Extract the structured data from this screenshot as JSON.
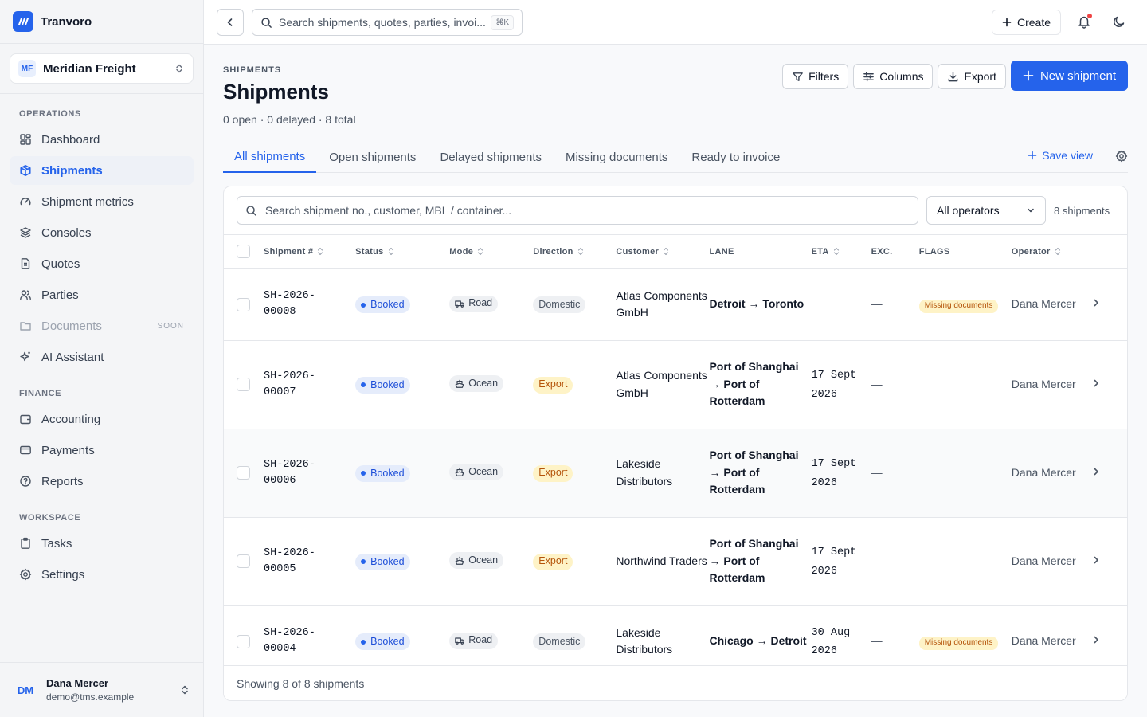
{
  "app": {
    "brand": "Tranvoro",
    "org": {
      "initials": "MF",
      "name": "Meridian Freight"
    },
    "accent": "#2563eb"
  },
  "sidebar": {
    "sections": [
      {
        "heading": "OPERATIONS",
        "items": [
          {
            "label": "Dashboard",
            "icon": "dashboard-icon"
          },
          {
            "label": "Shipments",
            "icon": "package-icon",
            "active": true
          },
          {
            "label": "Shipment metrics",
            "icon": "gauge-icon"
          },
          {
            "label": "Consoles",
            "icon": "layers-icon"
          },
          {
            "label": "Quotes",
            "icon": "file-text-icon"
          },
          {
            "label": "Parties",
            "icon": "users-icon"
          },
          {
            "label": "Documents",
            "icon": "folder-icon",
            "disabled": true,
            "tag": "SOON"
          },
          {
            "label": "AI Assistant",
            "icon": "sparkles-icon"
          }
        ]
      },
      {
        "heading": "FINANCE",
        "items": [
          {
            "label": "Accounting",
            "icon": "wallet-icon"
          },
          {
            "label": "Payments",
            "icon": "credit-card-icon"
          },
          {
            "label": "Reports",
            "icon": "help-circle-icon"
          }
        ]
      },
      {
        "heading": "WORKSPACE",
        "items": [
          {
            "label": "Tasks",
            "icon": "clipboard-icon"
          },
          {
            "label": "Settings",
            "icon": "gear-icon"
          }
        ]
      }
    ],
    "user": {
      "initials": "DM",
      "name": "Dana Mercer",
      "email": "demo@tms.example"
    }
  },
  "topbar": {
    "search_placeholder": "Search shipments, quotes, parties, invoi...",
    "shortcut": "⌘K",
    "create_label": "Create"
  },
  "page": {
    "eyebrow": "SHIPMENTS",
    "title": "Shipments",
    "subtitle": "0 open · 0 delayed · 8 total",
    "actions": {
      "filters": "Filters",
      "columns": "Columns",
      "export": "Export",
      "new": "New shipment"
    },
    "tabs": [
      "All shipments",
      "Open shipments",
      "Delayed shipments",
      "Missing documents",
      "Ready to invoice"
    ],
    "active_tab": 0,
    "save_view": "Save view"
  },
  "table": {
    "search_placeholder": "Search shipment no., customer, MBL / container...",
    "operator_filter": "All operators",
    "count": "8 shipments",
    "columns": [
      "Shipment #",
      "Status",
      "Mode",
      "Direction",
      "Customer",
      "LANE",
      "ETA",
      "EXC.",
      "FLAGS",
      "Operator"
    ],
    "rows": [
      {
        "id_a": "SH-2026-",
        "id_b": "00008",
        "status": "Booked",
        "mode": "Road",
        "direction": "Domestic",
        "customer": "Atlas Components GmbH",
        "lane": "Detroit → Toronto",
        "eta": "–",
        "exc": "—",
        "flag": "Missing documents",
        "operator": "Dana Mercer"
      },
      {
        "id_a": "SH-2026-",
        "id_b": "00007",
        "status": "Booked",
        "mode": "Ocean",
        "direction": "Export",
        "customer": "Atlas Components GmbH",
        "lane": "Port of Shanghai → Port of Rotterdam",
        "eta": "17 Sept 2026",
        "exc": "—",
        "flag": "",
        "operator": "Dana Mercer"
      },
      {
        "id_a": "SH-2026-",
        "id_b": "00006",
        "status": "Booked",
        "mode": "Ocean",
        "direction": "Export",
        "customer": "Lakeside Distributors",
        "lane": "Port of Shanghai → Port of Rotterdam",
        "eta": "17 Sept 2026",
        "exc": "—",
        "flag": "",
        "operator": "Dana Mercer",
        "hover": true
      },
      {
        "id_a": "SH-2026-",
        "id_b": "00005",
        "status": "Booked",
        "mode": "Ocean",
        "direction": "Export",
        "customer": "Northwind Traders",
        "lane": "Port of Shanghai → Port of Rotterdam",
        "eta": "17 Sept 2026",
        "exc": "—",
        "flag": "",
        "operator": "Dana Mercer"
      },
      {
        "id_a": "SH-2026-",
        "id_b": "00004",
        "status": "Booked",
        "mode": "Road",
        "direction": "Domestic",
        "customer": "Lakeside Distributors",
        "lane": "Chicago → Detroit",
        "eta": "30 Aug 2026",
        "exc": "—",
        "flag": "Missing documents",
        "operator": "Dana Mercer"
      }
    ],
    "footer": "Showing 8 of 8 shipments"
  }
}
